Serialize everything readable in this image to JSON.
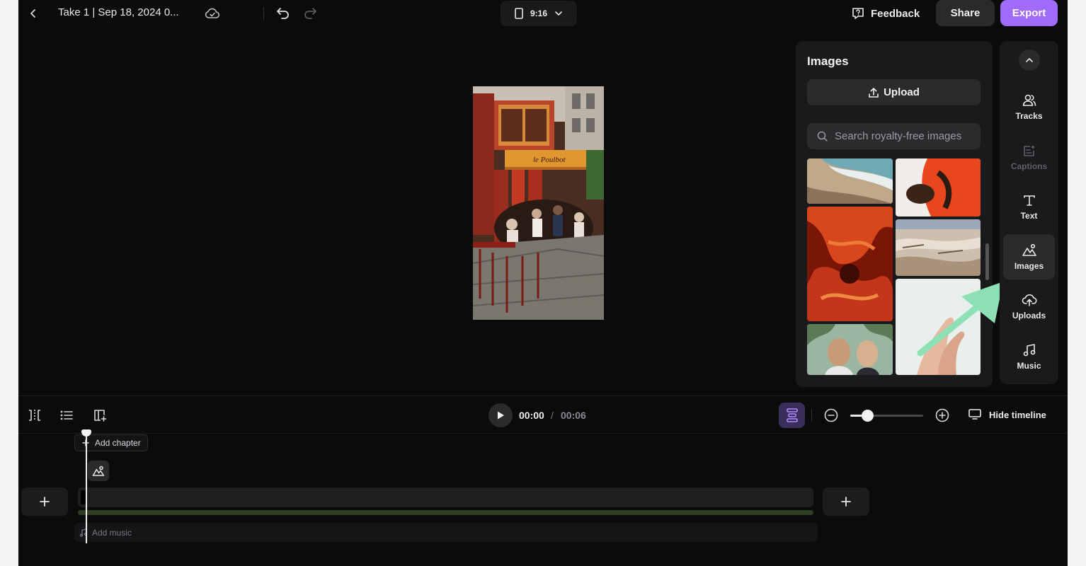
{
  "header": {
    "project_title": "Take 1 | Sep 18, 2024 0...",
    "aspect_ratio": "9:16",
    "feedback_label": "Feedback",
    "share_label": "Share",
    "export_label": "Export"
  },
  "images_panel": {
    "title": "Images",
    "upload_label": "Upload",
    "search_placeholder": "Search royalty-free images"
  },
  "rail": {
    "items": [
      {
        "label": "Tracks",
        "icon": "users-icon",
        "state": "normal"
      },
      {
        "label": "Captions",
        "icon": "captions-icon",
        "state": "disabled"
      },
      {
        "label": "Text",
        "icon": "text-icon",
        "state": "normal"
      },
      {
        "label": "Images",
        "icon": "image-icon",
        "state": "active"
      },
      {
        "label": "Uploads",
        "icon": "cloud-upload-icon",
        "state": "normal"
      },
      {
        "label": "Music",
        "icon": "music-note-icon",
        "state": "normal"
      }
    ]
  },
  "timeline": {
    "current_time": "00:00",
    "separator": "/",
    "total_time": "00:06",
    "hide_label": "Hide timeline",
    "add_chapter_label": "Add chapter",
    "add_music_label": "Add music",
    "zoom_level_fraction": 0.24
  },
  "colors": {
    "accent": "#a06bfa",
    "background": "#0b0b0c",
    "panel": "#1a1a1c",
    "annotation_arrow": "#8de0b4"
  }
}
